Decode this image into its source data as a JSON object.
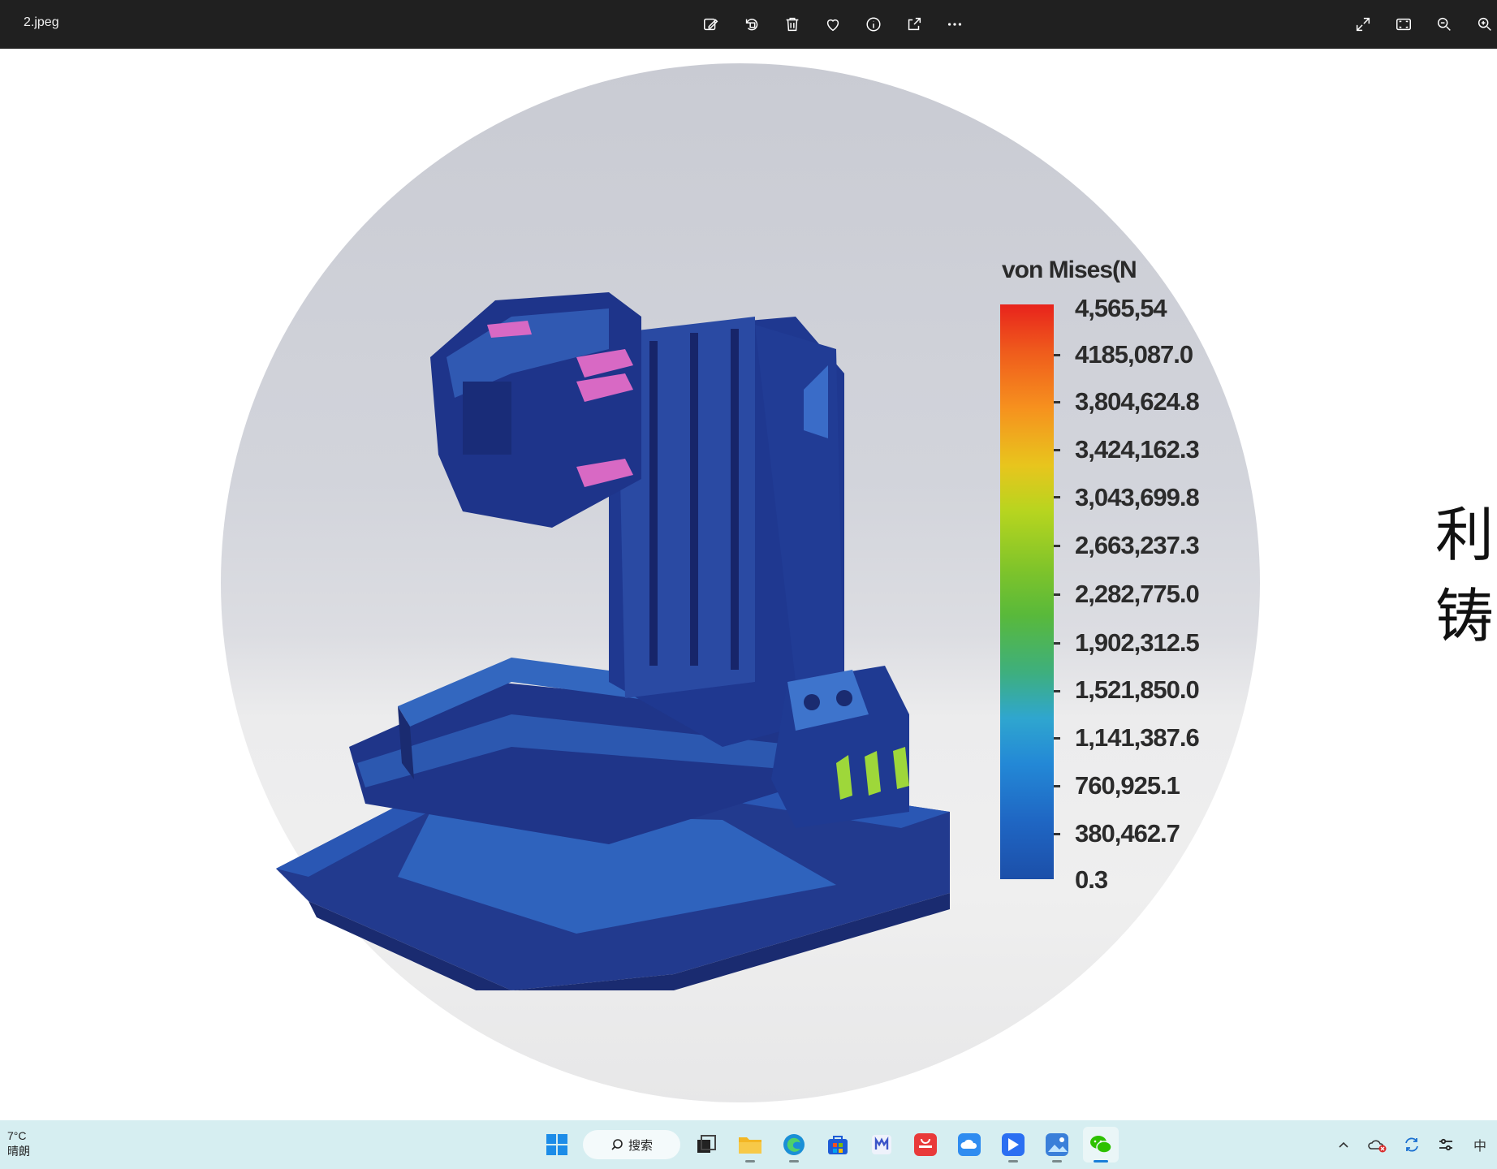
{
  "window": {
    "filename": "2.jpeg",
    "toolbar_icons": [
      "edit-image-icon",
      "rotate-icon",
      "trash-icon",
      "heart-icon",
      "info-icon",
      "share-icon",
      "more-icon"
    ],
    "right_icons": [
      "fullscreen-icon",
      "fit-to-window-icon",
      "zoom-out-icon",
      "zoom-in-icon"
    ]
  },
  "image": {
    "legend_title": "von Mises(N",
    "scale_labels": [
      "4,565,54",
      "4185,087.0",
      "3,804,624.8",
      "3,424,162.3",
      "3,043,699.8",
      "2,663,237.3",
      "2,282,775.0",
      "1,902,312.5",
      "1,521,850.0",
      "1,141,387.6",
      "760,925.1",
      "380,462.7",
      "0.3"
    ],
    "side_text": [
      "利",
      "铸"
    ]
  },
  "taskbar": {
    "temperature": "7°C",
    "weather": "晴朗",
    "search_label": "搜索",
    "tray_ime": "中"
  }
}
